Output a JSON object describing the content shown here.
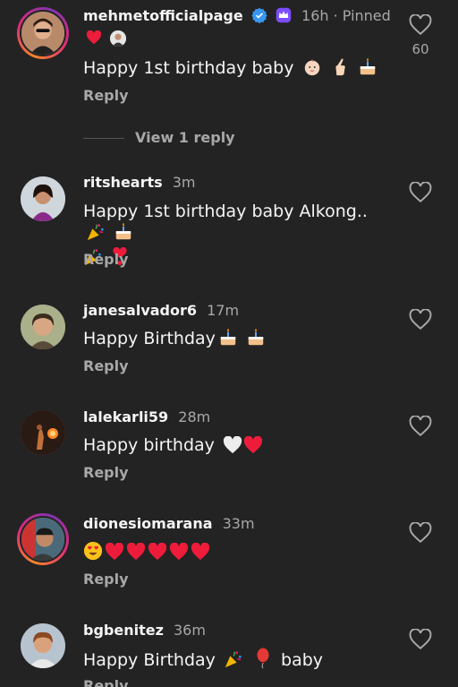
{
  "comments": [
    {
      "username": "mehmetofficialpage",
      "time": "16h",
      "pinned": "· Pinned",
      "text": "Happy 1st birthday baby",
      "emojis": [
        "baby-emoji",
        "crossed-fingers-emoji",
        "cake-emoji"
      ],
      "reply_label": "Reply",
      "likes": "60",
      "view_replies": "View 1 reply"
    },
    {
      "username": "ritshearts",
      "time": "3m",
      "text": "Happy 1st birthday baby Alkong..",
      "emojis": [
        "party-popper-emoji",
        "cake-emoji",
        "party-popper-emoji",
        "heart-exclamation-emoji"
      ],
      "reply_label": "Reply"
    },
    {
      "username": "janesalvador6",
      "time": "17m",
      "text": "Happy Birthday",
      "emojis": [
        "cake-emoji",
        "cake-emoji"
      ],
      "reply_label": "Reply"
    },
    {
      "username": "lalekarli59",
      "time": "28m",
      "text": "Happy birthday",
      "emojis": [
        "white-heart-emoji",
        "red-heart-emoji"
      ],
      "reply_label": "Reply"
    },
    {
      "username": "dionesiomarana",
      "time": "33m",
      "text": "",
      "emojis": [
        "heart-eyes-emoji",
        "red-heart-emoji",
        "red-heart-emoji",
        "red-heart-emoji",
        "red-heart-emoji",
        "red-heart-emoji"
      ],
      "reply_label": "Reply"
    },
    {
      "username": "bgbenitez",
      "time": "36m",
      "text": "Happy Birthday",
      "text_after": "baby",
      "emojis": [
        "party-popper-emoji",
        "balloon-emoji"
      ],
      "reply_label": "Reply"
    }
  ],
  "colors": {
    "background": "#232323",
    "primary_text": "#f5f5f5",
    "secondary_text": "#a8a8a8",
    "verified_blue": "#3897f0",
    "badge_purple": "#7b4dff",
    "heart_red": "#ed1c3a"
  }
}
